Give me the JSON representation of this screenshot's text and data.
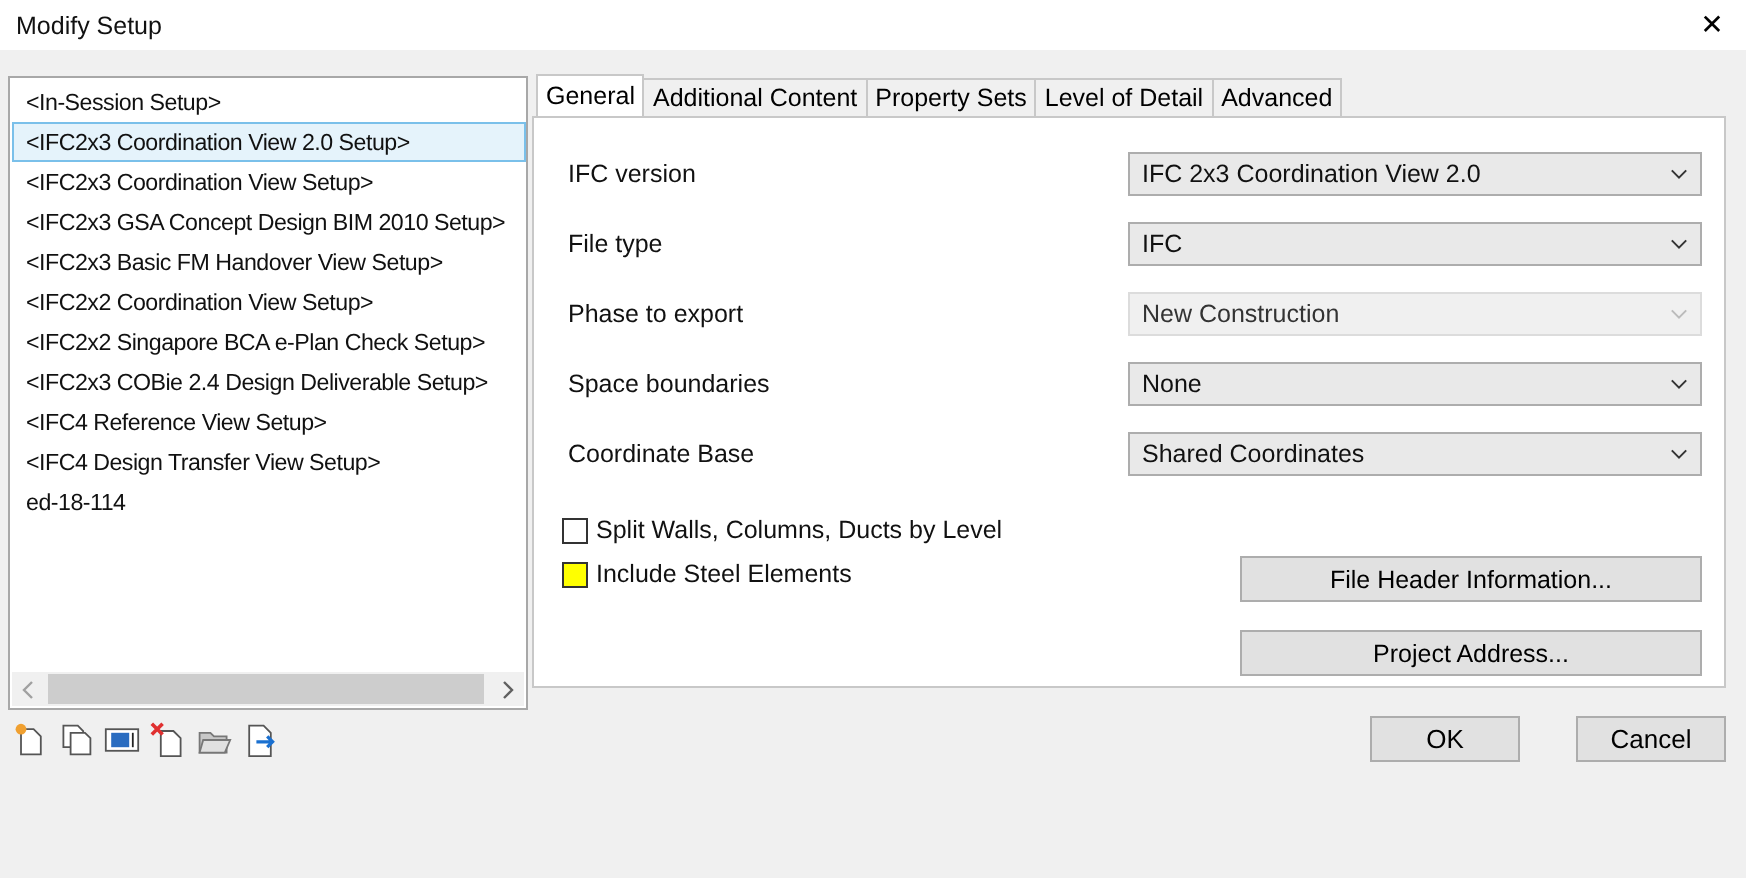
{
  "window": {
    "title": "Modify Setup",
    "close": "✕"
  },
  "setups": [
    {
      "label": "<In-Session Setup>",
      "selected": false
    },
    {
      "label": "<IFC2x3 Coordination View 2.0 Setup>",
      "selected": true
    },
    {
      "label": "<IFC2x3 Coordination View Setup>",
      "selected": false
    },
    {
      "label": "<IFC2x3 GSA Concept Design BIM 2010 Setup>",
      "selected": false
    },
    {
      "label": "<IFC2x3 Basic FM Handover View Setup>",
      "selected": false
    },
    {
      "label": "<IFC2x2 Coordination View Setup>",
      "selected": false
    },
    {
      "label": "<IFC2x2 Singapore BCA e-Plan Check Setup>",
      "selected": false
    },
    {
      "label": "<IFC2x3 COBie 2.4 Design Deliverable Setup>",
      "selected": false
    },
    {
      "label": "<IFC4 Reference View Setup>",
      "selected": false
    },
    {
      "label": "<IFC4 Design Transfer View Setup>",
      "selected": false
    },
    {
      "label": "ed-18-114",
      "selected": false
    }
  ],
  "toolbar": [
    {
      "kind": "new"
    },
    {
      "kind": "duplicate"
    },
    {
      "kind": "rename"
    },
    {
      "kind": "delete"
    },
    {
      "kind": "import"
    },
    {
      "kind": "export"
    }
  ],
  "tabs": [
    {
      "label": "General",
      "selected": true
    },
    {
      "label": "Additional Content",
      "selected": false
    },
    {
      "label": "Property Sets",
      "selected": false
    },
    {
      "label": "Level of Detail",
      "selected": false
    },
    {
      "label": "Advanced",
      "selected": false
    }
  ],
  "settings": [
    {
      "label": "IFC version",
      "value": "IFC 2x3 Coordination View 2.0",
      "disabled": false
    },
    {
      "label": "File type",
      "value": "IFC",
      "disabled": false
    },
    {
      "label": "Phase to export",
      "value": "New Construction",
      "disabled": true
    },
    {
      "label": "Space boundaries",
      "value": "None",
      "disabled": false
    },
    {
      "label": "Coordinate Base",
      "value": "Shared Coordinates",
      "disabled": false
    }
  ],
  "checkboxes": [
    {
      "label": "Split Walls, Columns, Ducts by Level",
      "checked": false,
      "highlighted": false
    },
    {
      "label": "Include Steel Elements",
      "checked": false,
      "highlighted": true
    }
  ],
  "panel_buttons": [
    "File Header Information...",
    "Project Address..."
  ],
  "buttons": [
    "OK",
    "Cancel"
  ]
}
